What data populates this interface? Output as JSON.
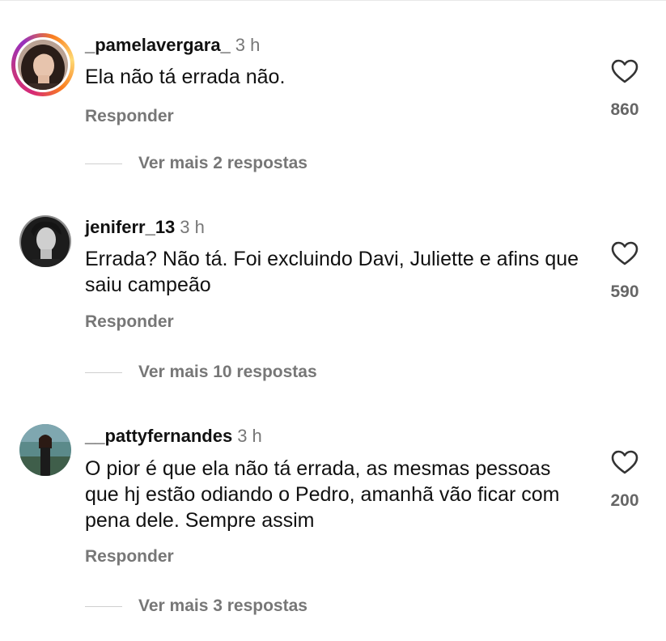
{
  "comments": [
    {
      "username": "_pamelavergara_",
      "time": "3 h",
      "text": "Ela não tá errada não.",
      "reply_label": "Responder",
      "likes": "860",
      "more_replies": "Ver mais 2 respostas",
      "story_ring": true
    },
    {
      "username": "jeniferr_13",
      "time": "3 h",
      "text": "Errada? Não tá. Foi excluindo Davi, Juliette e afins que saiu campeão",
      "reply_label": "Responder",
      "likes": "590",
      "more_replies": "Ver mais 10 respostas",
      "story_ring": false
    },
    {
      "username": "__pattyfernandes",
      "time": "3 h",
      "text": "O pior é que ela não tá errada, as mesmas pessoas que hj estão odiando o Pedro, amanhã vão ficar com pena dele. Sempre assim",
      "reply_label": "Responder",
      "likes": "200",
      "more_replies": "Ver mais 3 respostas",
      "story_ring": false
    }
  ],
  "icons": {
    "like": "heart-outline-icon"
  },
  "colors": {
    "secondary_text": "#777777",
    "story_ring_start": "#d62976",
    "story_ring_end": "#feda75"
  }
}
